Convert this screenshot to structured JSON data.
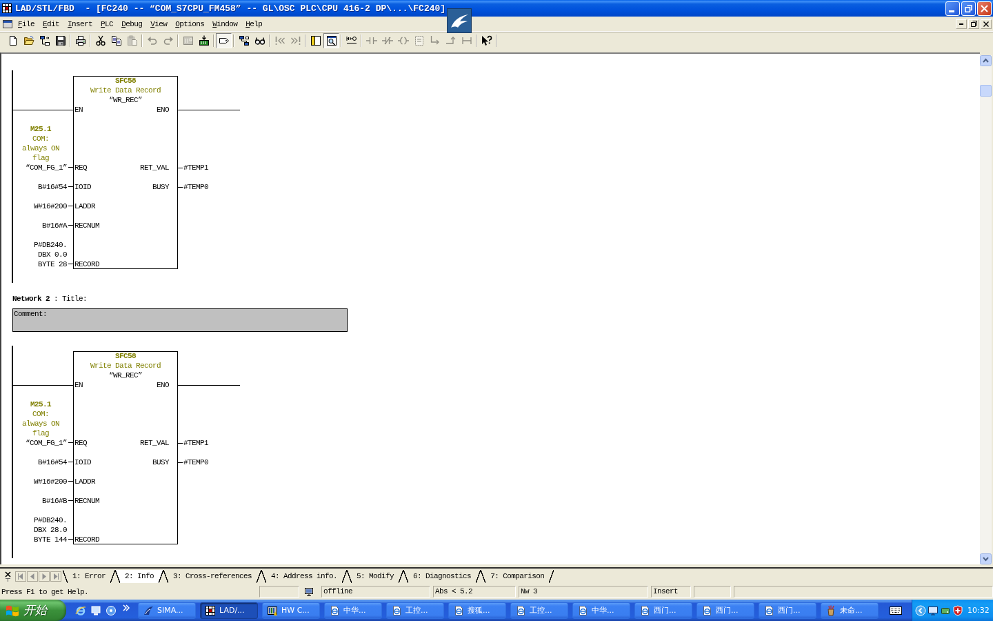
{
  "window": {
    "title": "LAD/STL/FBD  - [FC240 -- “COM_S7CPU_FM458” -- GL\\OSC PLC\\CPU 416-2 DP\\...\\FC240]"
  },
  "menu": [
    "File",
    "Edit",
    "Insert",
    "PLC",
    "Debug",
    "View",
    "Options",
    "Window",
    "Help"
  ],
  "toolbar": [
    {
      "buttons": [
        {
          "kind": "new",
          "disabled": false,
          "pressed": false
        },
        {
          "kind": "open",
          "disabled": false,
          "pressed": false
        },
        {
          "kind": "nodes",
          "disabled": false,
          "pressed": false
        },
        {
          "kind": "save",
          "disabled": false,
          "pressed": false
        }
      ]
    },
    {
      "buttons": [
        {
          "kind": "print",
          "disabled": false,
          "pressed": false
        }
      ]
    },
    {
      "buttons": [
        {
          "kind": "cut",
          "disabled": false,
          "pressed": false
        },
        {
          "kind": "copy",
          "disabled": false,
          "pressed": false
        },
        {
          "kind": "paste",
          "disabled": true,
          "pressed": false
        }
      ]
    },
    {
      "buttons": [
        {
          "kind": "undo",
          "disabled": true,
          "pressed": false
        },
        {
          "kind": "redo",
          "disabled": true,
          "pressed": false
        }
      ]
    },
    {
      "buttons": [
        {
          "kind": "module",
          "disabled": true,
          "pressed": false
        },
        {
          "kind": "download",
          "disabled": false,
          "pressed": false
        }
      ]
    },
    {
      "buttons": [
        {
          "kind": "tag",
          "disabled": false,
          "pressed": true
        }
      ]
    },
    {
      "buttons": [
        {
          "kind": "blocks",
          "disabled": false,
          "pressed": false
        },
        {
          "kind": "glasses",
          "disabled": false,
          "pressed": false
        }
      ]
    },
    {
      "buttons": [
        {
          "kind": "skip-back",
          "disabled": true,
          "pressed": false
        },
        {
          "kind": "skip-forward",
          "disabled": true,
          "pressed": false
        }
      ]
    },
    {
      "buttons": [
        {
          "kind": "panel",
          "disabled": false,
          "pressed": false
        },
        {
          "kind": "zoom",
          "disabled": false,
          "pressed": true
        }
      ]
    },
    {
      "buttons": [
        {
          "kind": "rung",
          "disabled": false,
          "pressed": false
        }
      ]
    },
    {
      "buttons": [
        {
          "kind": "contact",
          "disabled": true,
          "pressed": false
        },
        {
          "kind": "nc-contact",
          "disabled": true,
          "pressed": false
        },
        {
          "kind": "coil",
          "disabled": true,
          "pressed": false
        },
        {
          "kind": "box",
          "disabled": true,
          "pressed": false
        },
        {
          "kind": "branch",
          "disabled": true,
          "pressed": false
        },
        {
          "kind": "close-branch",
          "disabled": true,
          "pressed": false
        },
        {
          "kind": "connector",
          "disabled": true,
          "pressed": false
        }
      ]
    },
    {
      "buttons": [
        {
          "kind": "help",
          "disabled": false,
          "pressed": false
        }
      ]
    }
  ],
  "networks": [
    {
      "block": {
        "number": "SFC58",
        "name": "Write Data Record",
        "symbol": "“WR_REC”",
        "enable_in": "EN",
        "enable_out": "ENO",
        "inputs": [
          {
            "pin": "REQ",
            "address": "M25.1",
            "symbol_comment": [
              "COM:",
              "always ON",
              "flag"
            ],
            "operand": [
              "“COM_FG_1”"
            ]
          },
          {
            "pin": "IOID",
            "operand": [
              "B#16#54"
            ]
          },
          {
            "pin": "LADDR",
            "operand": [
              "W#16#200"
            ]
          },
          {
            "pin": "RECNUM",
            "operand": [
              "B#16#A"
            ]
          },
          {
            "pin": "RECORD",
            "operand": [
              "P#DB240.",
              "DBX 0.0",
              "BYTE 28"
            ]
          }
        ],
        "outputs": [
          {
            "pin": "RET_VAL",
            "operand": "#TEMP1"
          },
          {
            "pin": "BUSY",
            "operand": "#TEMP0"
          }
        ]
      }
    },
    {
      "title": "**Network 2** : Title:",
      "comment": "Comment:",
      "block": {
        "number": "SFC58",
        "name": "Write Data Record",
        "symbol": "“WR_REC”",
        "enable_in": "EN",
        "enable_out": "ENO",
        "inputs": [
          {
            "pin": "REQ",
            "address": "M25.1",
            "symbol_comment": [
              "COM:",
              "always ON",
              "flag"
            ],
            "operand": [
              "“COM_FG_1”"
            ]
          },
          {
            "pin": "IOID",
            "operand": [
              "B#16#54"
            ]
          },
          {
            "pin": "LADDR",
            "operand": [
              "W#16#200"
            ]
          },
          {
            "pin": "RECNUM",
            "operand": [
              "B#16#B"
            ]
          },
          {
            "pin": "RECORD",
            "operand": [
              "P#DB240.",
              "DBX 28.0",
              "BYTE 144"
            ]
          }
        ],
        "outputs": [
          {
            "pin": "RET_VAL",
            "operand": "#TEMP1"
          },
          {
            "pin": "BUSY",
            "operand": "#TEMP0"
          }
        ]
      }
    }
  ],
  "details_tabs": [
    {
      "label": "1: Error",
      "selected": false
    },
    {
      "label": "2: Info",
      "selected": true
    },
    {
      "label": "3: Cross-references",
      "selected": false
    },
    {
      "label": "4: Address info.",
      "selected": false
    },
    {
      "label": "5: Modify",
      "selected": false
    },
    {
      "label": "6: Diagnostics",
      "selected": false
    },
    {
      "label": "7: Comparison",
      "selected": false
    }
  ],
  "status_bar": {
    "help": "Press F1 to get Help.",
    "panels": [
      {
        "kind": "empty"
      },
      {
        "kind": "connection",
        "text": "offline"
      },
      {
        "kind": "text",
        "text": "Abs < 5.2"
      },
      {
        "kind": "text",
        "text": "Nw 3"
      },
      {
        "kind": "text",
        "text": "Insert"
      },
      {
        "kind": "empty"
      },
      {
        "kind": "empty"
      }
    ]
  },
  "taskbar": {
    "start": "开始",
    "tasks": [
      {
        "kind": "simatic",
        "label": "SIMA...",
        "selected": false
      },
      {
        "kind": "lad",
        "label": "LAD/...",
        "selected": true
      },
      {
        "kind": "hardware",
        "label": "HW C...",
        "selected": false
      },
      {
        "kind": "web",
        "label": "中华...",
        "selected": false
      },
      {
        "kind": "web",
        "label": "工控...",
        "selected": false
      },
      {
        "kind": "web",
        "label": "搜狐...",
        "selected": false
      },
      {
        "kind": "web",
        "label": "工控...",
        "selected": false
      },
      {
        "kind": "web",
        "label": "中华...",
        "selected": false
      },
      {
        "kind": "web",
        "label": "西门...",
        "selected": false
      },
      {
        "kind": "web",
        "label": "西门...",
        "selected": false
      },
      {
        "kind": "web",
        "label": "西门...",
        "selected": false
      },
      {
        "kind": "paint",
        "label": "未命...",
        "selected": false
      }
    ],
    "clock": "10:32"
  }
}
